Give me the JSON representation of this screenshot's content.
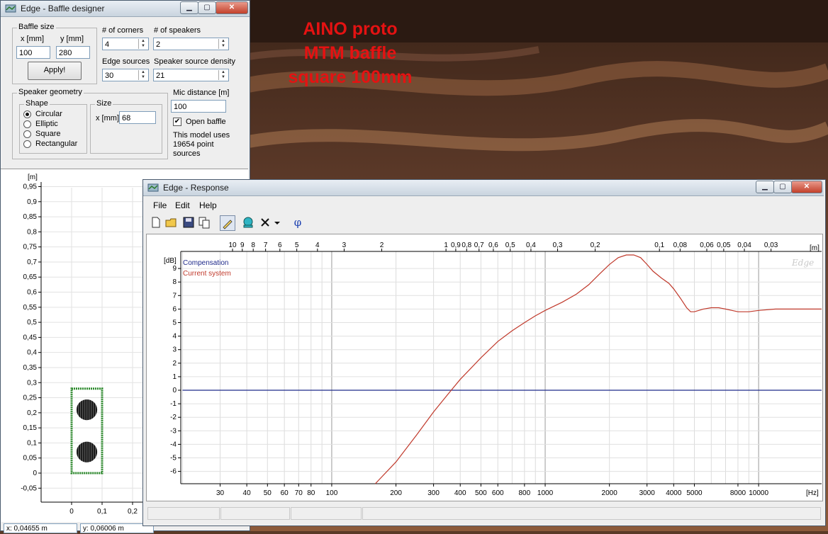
{
  "overlay_text": [
    "AINO proto",
    "MTM baffle",
    "square 100mm"
  ],
  "baffle_window": {
    "title": "Edge - Baffle designer",
    "baffle_size": {
      "legend": "Baffle size",
      "x_label": "x [mm]",
      "y_label": "y [mm]",
      "x_value": "100",
      "y_value": "280",
      "apply_label": "Apply!"
    },
    "corners": {
      "label": "# of corners",
      "value": "4"
    },
    "speakers": {
      "label": "# of speakers",
      "value": "2"
    },
    "edge_sources": {
      "label": "Edge sources",
      "value": "30"
    },
    "source_density": {
      "label": "Speaker source density",
      "value": "21"
    },
    "speaker_geometry": {
      "legend": "Speaker geometry",
      "shape_legend": "Shape",
      "shapes": [
        "Circular",
        "Elliptic",
        "Square",
        "Rectangular"
      ],
      "selected": "Circular",
      "size_legend": "Size",
      "size_label": "x [mm]",
      "size_value": "68"
    },
    "mic_distance": {
      "label": "Mic distance [m]",
      "value": "100"
    },
    "open_baffle": {
      "label": "Open baffle",
      "checked": true
    },
    "model_info": [
      "This model uses",
      "19654 point",
      "sources"
    ],
    "plot": {
      "unit": "[m]",
      "y_ticks": [
        "0,95",
        "0,9",
        "0,85",
        "0,8",
        "0,75",
        "0,7",
        "0,65",
        "0,6",
        "0,55",
        "0,5",
        "0,45",
        "0,4",
        "0,35",
        "0,3",
        "0,25",
        "0,2",
        "0,15",
        "0,1",
        "0,05",
        "0",
        "-0,05"
      ],
      "x_ticks": [
        "0",
        "0,1",
        "0,2"
      ]
    },
    "status": [
      "x: 0,04655 m",
      "y: 0,06006 m"
    ]
  },
  "response_window": {
    "title": "Edge - Response",
    "menu": [
      "File",
      "Edit",
      "Help"
    ],
    "toolbar": [
      "new-file-icon",
      "open-folder-icon",
      "save-icon",
      "copy-icon",
      "pencil-icon",
      "speaker-icon",
      "close-icon",
      "dropdown-arrow-icon",
      "phi-icon"
    ],
    "toolbar_phi": "φ",
    "watermark": "Edge",
    "legend": [
      "Compensation",
      "Current system"
    ],
    "colors": {
      "compensation": "#1f2a8a",
      "current": "#c0392b"
    }
  },
  "chart_data": {
    "type": "line",
    "xscale": "log",
    "xlabel": "[Hz]",
    "ylabel": "[dB]",
    "top_axis_label": "[m]",
    "xlim": [
      20,
      20000
    ],
    "ylim": [
      -7,
      10
    ],
    "y_ticks": [
      -6,
      -5,
      -4,
      -3,
      -2,
      -1,
      0,
      1,
      2,
      3,
      4,
      5,
      6,
      7,
      8,
      9
    ],
    "x_tick_labels": [
      30,
      40,
      50,
      60,
      70,
      80,
      100,
      200,
      300,
      400,
      500,
      600,
      800,
      1000,
      2000,
      3000,
      4000,
      5000,
      8000,
      10000
    ],
    "top_tick_labels": [
      {
        "label": "10",
        "m": 10
      },
      {
        "label": "9",
        "m": 9
      },
      {
        "label": "8",
        "m": 8
      },
      {
        "label": "7",
        "m": 7
      },
      {
        "label": "6",
        "m": 6
      },
      {
        "label": "5",
        "m": 5
      },
      {
        "label": "4",
        "m": 4
      },
      {
        "label": "3",
        "m": 3
      },
      {
        "label": "2",
        "m": 2
      },
      {
        "label": "1",
        "m": 1
      },
      {
        "label": "0,9",
        "m": 0.9
      },
      {
        "label": "0,8",
        "m": 0.8
      },
      {
        "label": "0,7",
        "m": 0.7
      },
      {
        "label": "0,6",
        "m": 0.6
      },
      {
        "label": "0,5",
        "m": 0.5
      },
      {
        "label": "0,4",
        "m": 0.4
      },
      {
        "label": "0,3",
        "m": 0.3
      },
      {
        "label": "0,2",
        "m": 0.2
      },
      {
        "label": "0,1",
        "m": 0.1
      },
      {
        "label": "0,08",
        "m": 0.08
      },
      {
        "label": "0,06",
        "m": 0.06
      },
      {
        "label": "0,05",
        "m": 0.05
      },
      {
        "label": "0,04",
        "m": 0.04
      },
      {
        "label": "0,03",
        "m": 0.03
      }
    ],
    "grid": true,
    "series": [
      {
        "name": "Compensation",
        "x": [
          20,
          20000
        ],
        "y": [
          0,
          0
        ]
      },
      {
        "name": "Current system",
        "x": [
          160,
          200,
          250,
          300,
          350,
          400,
          500,
          600,
          700,
          800,
          900,
          1000,
          1200,
          1400,
          1600,
          1800,
          2000,
          2200,
          2400,
          2600,
          2800,
          3000,
          3200,
          3500,
          3800,
          4000,
          4300,
          4600,
          4800,
          5000,
          5500,
          6000,
          6500,
          7000,
          7500,
          8000,
          9000,
          10000,
          12000,
          14000,
          16000,
          18000,
          20000
        ],
        "y": [
          -7,
          -5.3,
          -3.3,
          -1.6,
          -0.3,
          0.8,
          2.4,
          3.6,
          4.4,
          5.0,
          5.5,
          5.9,
          6.5,
          7.1,
          7.8,
          8.6,
          9.3,
          9.8,
          10.0,
          10.0,
          9.8,
          9.3,
          8.8,
          8.3,
          7.9,
          7.5,
          6.8,
          6.1,
          5.8,
          5.8,
          6.0,
          6.1,
          6.1,
          6.0,
          5.9,
          5.8,
          5.8,
          5.9,
          6.0,
          6.0,
          6.0,
          6.0,
          6.0
        ]
      }
    ]
  }
}
